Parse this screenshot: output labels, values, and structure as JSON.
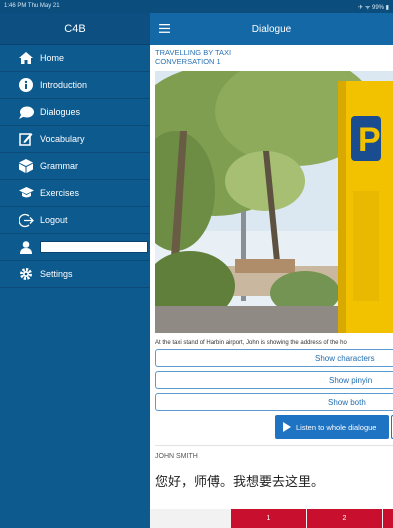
{
  "status_bar": {
    "time": "1:46 PM  Thu May 21",
    "right": "✈ ᯤ 99% ▮"
  },
  "sidebar": {
    "title": "C4B",
    "items": [
      {
        "label": "Home",
        "icon": "home-icon"
      },
      {
        "label": "Introduction",
        "icon": "info-icon"
      },
      {
        "label": "Dialogues",
        "icon": "chat-bubble-icon"
      },
      {
        "label": "Vocabulary",
        "icon": "edit-icon"
      },
      {
        "label": "Grammar",
        "icon": "cube-icon"
      },
      {
        "label": "Exercises",
        "icon": "graduation-cap-icon"
      },
      {
        "label": "Logout",
        "icon": "logout-icon"
      }
    ],
    "user_field_value": "",
    "settings_label": "Settings"
  },
  "main": {
    "title": "Dialogue",
    "lesson_title_line1": "TRAVELLING BY TAXI",
    "lesson_title_line2": "CONVERSATION 1",
    "caption": "At the taxi stand of Harbin airport, John is showing the address of the ho",
    "show_characters": "Show characters",
    "show_pinyin": "Show pinyin",
    "show_both": "Show both",
    "listen_label": "Listen to whole dialogue",
    "speaker": "JOHN SMITH",
    "line": "您好，师傅。我想要去这里。",
    "tabs": [
      "1",
      "2"
    ]
  },
  "colors": {
    "sidebar": "#0d5a8f",
    "topbar": "#1568a6",
    "accent": "#1f73c3",
    "tab_red": "#c8102e"
  }
}
